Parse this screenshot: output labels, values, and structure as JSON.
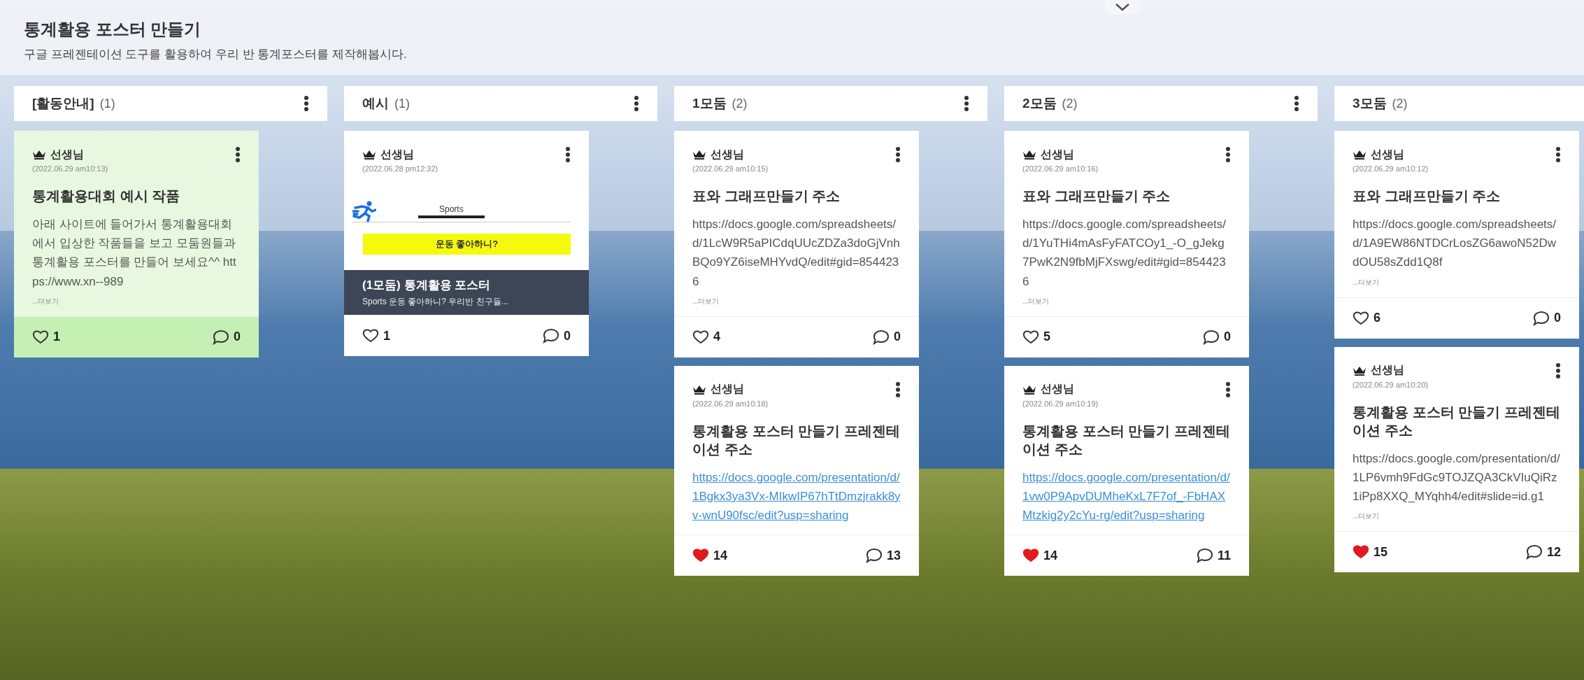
{
  "board": {
    "title": "통계활용 포스터 만들기",
    "subtitle": "구글 프레젠테이션 도구를 활용하여 우리 반 통계포스터를 제작해봅시다."
  },
  "columns": [
    {
      "title": "[활동안내]",
      "count": "(1)",
      "posts": [
        {
          "kind": "text",
          "highlighted": true,
          "author": "선생님",
          "time": "(2022.06.29 am10:13)",
          "title": "통계활용대회 예시 작품",
          "body": "아래 사이트에 들어가서 통계활용대회에서 입상한 작품들을 보고 모둠원들과 통계활용 포스터를 만들어 보세요^^ https://www.xn--989",
          "more": "...더보기",
          "liked": false,
          "likes": "1",
          "comments": "0"
        }
      ]
    },
    {
      "title": "예시",
      "count": "(1)",
      "posts": [
        {
          "kind": "image",
          "highlighted": false,
          "author": "선생님",
          "time": "(2022.06.28 pm12:32)",
          "preview_tab": "Sports",
          "preview_question": "운동 좋아하니?",
          "caption": "(1모둠) 통계활용 포스터",
          "caption_sub": "Sports 운동 좋아하니? 우리반 친구들...",
          "liked": false,
          "likes": "1",
          "comments": "0"
        }
      ]
    },
    {
      "title": "1모둠",
      "count": "(2)",
      "posts": [
        {
          "kind": "text",
          "highlighted": false,
          "author": "선생님",
          "time": "(2022.06.29 am10:15)",
          "title": "표와 그래프만들기 주소",
          "body": "https://docs.google.com/spreadsheets/d/1LcW9R5aPICdqUUcZDZa3doGjVnhBQo9YZ6iseMHYvdQ/edit#gid=8544236",
          "more": "...더보기",
          "liked": false,
          "likes": "4",
          "comments": "0"
        },
        {
          "kind": "link",
          "highlighted": false,
          "author": "선생님",
          "time": "(2022.06.29 am10:18)",
          "title": "통계활용 포스터 만들기 프레젠테이션 주소",
          "body": "https://docs.google.com/presentation/d/1Bgkx3ya3Vx-MIkwIP67hTtDmzjrakk8yv-wnU90fsc/edit?usp=sharing",
          "liked": true,
          "likes": "14",
          "comments": "13"
        }
      ]
    },
    {
      "title": "2모둠",
      "count": "(2)",
      "posts": [
        {
          "kind": "text",
          "highlighted": false,
          "author": "선생님",
          "time": "(2022.06.29 am10:16)",
          "title": "표와 그래프만들기 주소",
          "body": "https://docs.google.com/spreadsheets/d/1YuTHi4mAsFyFATCOy1_-O_gJekg7PwK2N9fbMjFXswg/edit#gid=8544236",
          "more": "...더보기",
          "liked": false,
          "likes": "5",
          "comments": "0"
        },
        {
          "kind": "link",
          "highlighted": false,
          "author": "선생님",
          "time": "(2022.06.29 am10:19)",
          "title": "통계활용 포스터 만들기 프레젠테이션 주소",
          "body": "https://docs.google.com/presentation/d/1vw0P9ApvDUMheKxL7F7of_-FbHAXMtzkig2y2cYu-rg/edit?usp=sharing",
          "liked": true,
          "likes": "14",
          "comments": "11"
        }
      ]
    },
    {
      "title": "3모둠",
      "count": "(2)",
      "posts": [
        {
          "kind": "text",
          "highlighted": false,
          "author": "선생님",
          "time": "(2022.06.29 am10:12)",
          "title": "표와 그래프만들기 주소",
          "body": "https://docs.google.com/spreadsheets/d/1A9EW86NTDCrLosZG6awoN52DwdOU58sZdd1Q8f",
          "more": "...더보기",
          "liked": false,
          "likes": "6",
          "comments": "0"
        },
        {
          "kind": "text",
          "highlighted": false,
          "author": "선생님",
          "time": "(2022.06.29 am10:20)",
          "title": "통계활용 포스터 만들기 프레젠테이션 주소",
          "body": "https://docs.google.com/presentation/d/1LP6vmh9FdGc9TOJZQA3CkVIuQiRz1iPp8XXQ_MYqhh4/edit#slide=id.g1",
          "more": "...더보기",
          "liked": true,
          "likes": "15",
          "comments": "12"
        }
      ]
    }
  ]
}
